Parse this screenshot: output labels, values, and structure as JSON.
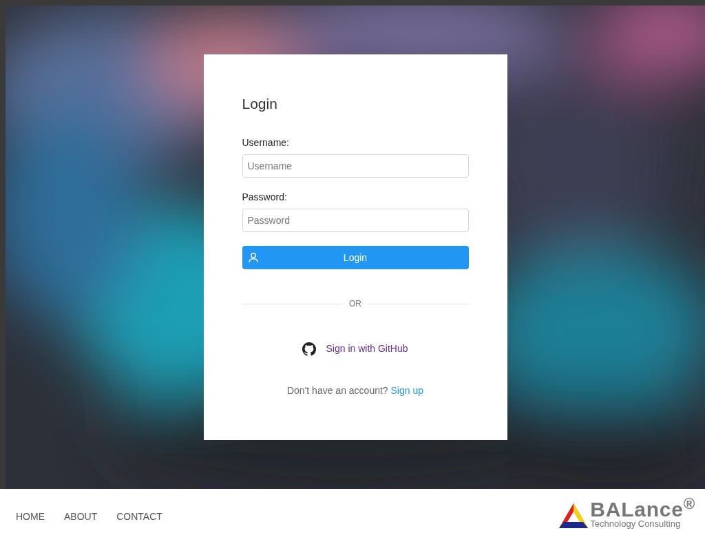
{
  "login_card": {
    "title": "Login",
    "fields": [
      {
        "label": "Username:",
        "placeholder": "Username"
      },
      {
        "label": "Password:",
        "placeholder": "Password"
      }
    ],
    "login_button": "Login",
    "divider": "OR",
    "github_link": "Sign in with GitHub",
    "signup_prompt": "Don't have an account?",
    "signup_link": "Sign up"
  },
  "footer": {
    "nav": [
      "HOME",
      "ABOUT",
      "CONTACT"
    ],
    "logo": {
      "name": "BALance$^{®}$",
      "tagline": "Technology Consulting"
    }
  }
}
